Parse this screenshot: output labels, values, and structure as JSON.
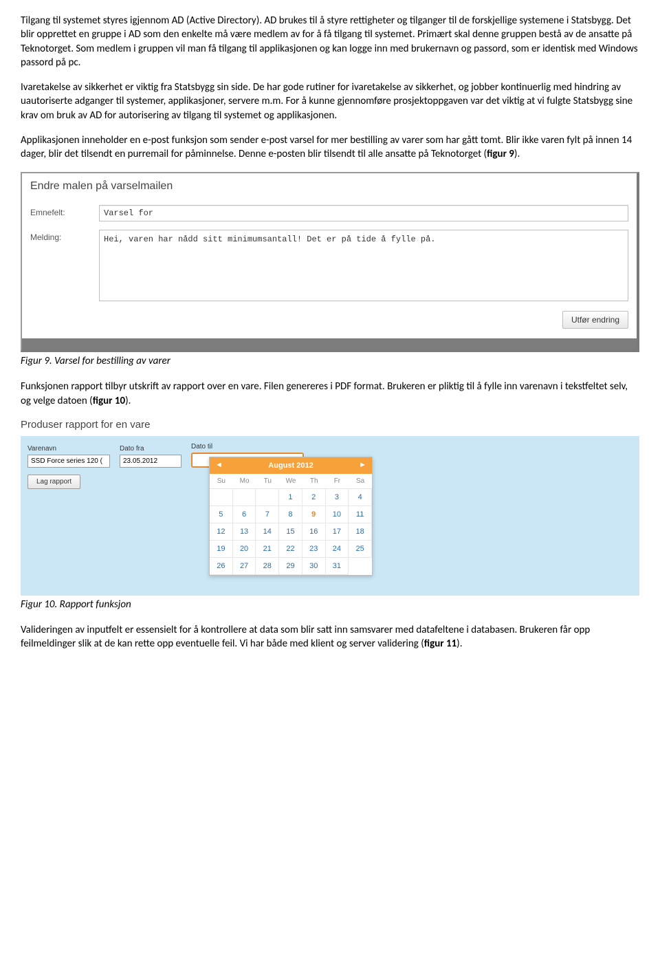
{
  "p1": "Tilgang til systemet styres igjennom AD (Active Directory). AD brukes til å styre rettigheter og tilganger til de forskjellige systemene i Statsbygg. Det blir opprettet en gruppe i AD som den enkelte må være medlem av for å få tilgang til systemet. Primært skal denne gruppen bestå av de ansatte på Teknotorget. Som medlem i gruppen vil man få tilgang til applikasjonen og kan logge inn med brukernavn og passord, som er identisk med Windows passord på pc.",
  "p2": "Ivaretakelse av sikkerhet er viktig fra Statsbygg sin side. De har gode rutiner for ivaretakelse av sikkerhet, og jobber kontinuerlig med hindring av uautoriserte adganger til systemer, applikasjoner, servere m.m. For å kunne gjennomføre prosjektoppgaven var det viktig at vi fulgte Statsbygg sine krav om bruk av AD for autorisering av tilgang til systemet og applikasjonen.",
  "p3a": "Applikasjonen inneholder en e-post funksjon som sender e-post varsel for mer bestilling av varer som har gått tomt. Blir ikke varen fylt på innen 14 dager, blir det tilsendt en purremail for påminnelse. Denne e-posten blir tilsendt til alle ansatte på Teknotorget (",
  "p3b": "figur 9",
  "p3c": ").",
  "fig9": {
    "heading": "Endre malen på varselmailen",
    "label_emne": "Emnefelt:",
    "value_emne": "Varsel for",
    "label_melding": "Melding:",
    "value_melding": "Hei, varen har nådd sitt minimumsantall! Det er på tide å fylle på.",
    "btn": "Utfør endring",
    "caption": "Figur 9. Varsel for bestilling av varer"
  },
  "p4a": "Funksjonen rapport tilbyr utskrift av rapport over en vare. Filen genereres i PDF format. Brukeren er pliktig til å fylle inn varenavn i tekstfeltet selv, og velge datoen (",
  "p4b": "figur 10",
  "p4c": ").",
  "fig10": {
    "heading": "Produser rapport for en vare",
    "label_varenavn": "Varenavn",
    "value_varenavn": "SSD Force series 120 (",
    "label_datofra": "Dato fra",
    "value_datofra": "23.05.2012",
    "label_datotil": "Dato til",
    "btn": "Lag rapport",
    "cal_title": "August 2012",
    "dow": [
      "Su",
      "Mo",
      "Tu",
      "We",
      "Th",
      "Fr",
      "Sa"
    ],
    "days": [
      "",
      "",
      "",
      "1",
      "2",
      "3",
      "4",
      "5",
      "6",
      "7",
      "8",
      "9",
      "10",
      "11",
      "12",
      "13",
      "14",
      "15",
      "16",
      "17",
      "18",
      "19",
      "20",
      "21",
      "22",
      "23",
      "24",
      "25",
      "26",
      "27",
      "28",
      "29",
      "30",
      "31"
    ],
    "highlight": "9",
    "caption": "Figur 10. Rapport funksjon"
  },
  "p5a": "Valideringen av inputfelt er essensielt for å kontrollere at data som blir satt inn samsvarer med datafeltene i databasen. Brukeren får opp feilmeldinger slik at de kan rette opp eventuelle feil. Vi har både med klient og server validering (",
  "p5b": "figur 11",
  "p5c": ")."
}
